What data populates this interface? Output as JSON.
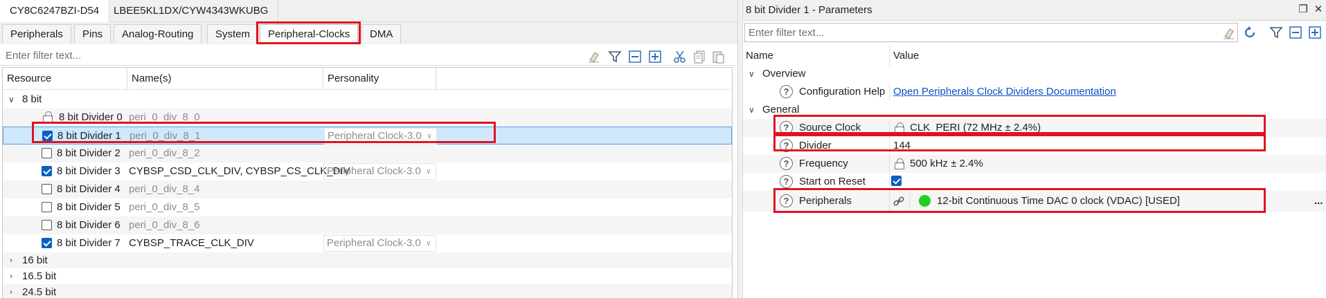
{
  "device_tabs": [
    "CY8C6247BZI-D54",
    "LBEE5KL1DX/CYW4343WKUBG"
  ],
  "sub_tabs": [
    "Peripherals",
    "Pins",
    "Analog-Routing",
    "System",
    "Peripheral-Clocks",
    "DMA"
  ],
  "left_filter": {
    "placeholder": "Enter filter text..."
  },
  "columns": {
    "resource": "Resource",
    "names": "Name(s)",
    "personality": "Personality"
  },
  "tree": {
    "group_8bit": "8 bit",
    "rows": [
      {
        "resource": "8 bit Divider 0",
        "name": "peri_0_div_8_0",
        "personality": "",
        "state": "locked"
      },
      {
        "resource": "8 bit Divider 1",
        "name": "peri_0_div_8_1",
        "personality": "Peripheral Clock-3.0",
        "state": "checked"
      },
      {
        "resource": "8 bit Divider 2",
        "name": "peri_0_div_8_2",
        "personality": "",
        "state": "unchecked"
      },
      {
        "resource": "8 bit Divider 3",
        "name": "CYBSP_CSD_CLK_DIV, CYBSP_CS_CLK_DIV",
        "personality": "Peripheral Clock-3.0",
        "state": "checked"
      },
      {
        "resource": "8 bit Divider 4",
        "name": "peri_0_div_8_4",
        "personality": "",
        "state": "unchecked"
      },
      {
        "resource": "8 bit Divider 5",
        "name": "peri_0_div_8_5",
        "personality": "",
        "state": "unchecked"
      },
      {
        "resource": "8 bit Divider 6",
        "name": "peri_0_div_8_6",
        "personality": "",
        "state": "unchecked"
      },
      {
        "resource": "8 bit Divider 7",
        "name": "CYBSP_TRACE_CLK_DIV",
        "personality": "Peripheral Clock-3.0",
        "state": "checked"
      }
    ],
    "collapsed_groups": [
      "16 bit",
      "16.5 bit",
      "24.5 bit"
    ]
  },
  "params": {
    "title": "8 bit Divider 1 - Parameters",
    "filter_placeholder": "Enter filter text...",
    "col_name": "Name",
    "col_value": "Value",
    "overview_label": "Overview",
    "config_help_label": "Configuration Help",
    "config_help_link": "Open Peripherals Clock Dividers Documentation",
    "general_label": "General",
    "source_clock_label": "Source Clock",
    "source_clock_value": "CLK_PERI (72 MHz ± 2.4%)",
    "divider_label": "Divider",
    "divider_value": "144",
    "frequency_label": "Frequency",
    "frequency_value": "500 kHz ± 2.4%",
    "start_on_reset_label": "Start on Reset",
    "start_on_reset": true,
    "peripherals_label": "Peripherals",
    "peripherals_value": "12-bit Continuous Time DAC 0 clock (VDAC) [USED]",
    "more": "..."
  },
  "colors": {
    "highlight": "#e0121f",
    "accent": "#0a5fc2",
    "used": "#1ed11e",
    "selection": "#cfe8fc"
  }
}
